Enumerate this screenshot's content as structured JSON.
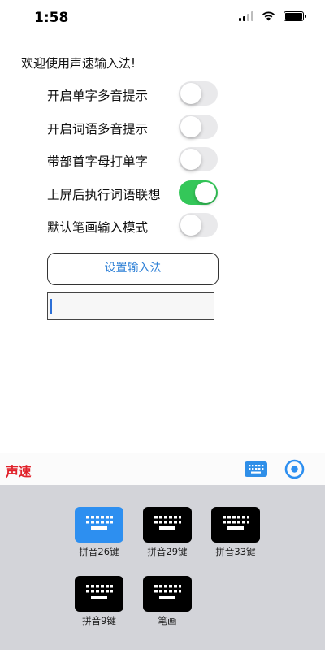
{
  "status_bar": {
    "time": "1:58",
    "icons": [
      "signal-icon",
      "wifi-icon",
      "battery-icon"
    ]
  },
  "welcome_text": "欢迎使用声速输入法!",
  "settings": [
    {
      "label": "开启单字多音提示",
      "enabled": false
    },
    {
      "label": "开启词语多音提示",
      "enabled": false
    },
    {
      "label": "带部首字母打单字",
      "enabled": false
    },
    {
      "label": "上屏后执行词语联想",
      "enabled": true
    },
    {
      "label": "默认笔画输入模式",
      "enabled": false
    }
  ],
  "setup_button_label": "设置输入法",
  "test_input": {
    "value": ""
  },
  "keyboard_toolbar": {
    "brand": "声速",
    "icons": [
      "keyboard-icon",
      "settings-target-icon"
    ]
  },
  "keyboard_layouts": [
    {
      "label": "拼音26键",
      "selected": true
    },
    {
      "label": "拼音29键",
      "selected": false
    },
    {
      "label": "拼音33键",
      "selected": false
    },
    {
      "label": "拼音9键",
      "selected": false
    },
    {
      "label": "笔画",
      "selected": false
    }
  ],
  "colors": {
    "toggle_on": "#34c759",
    "toggle_off": "#e9e9eb",
    "accent_blue": "#2d8ff0",
    "brand_red": "#e1212a",
    "keyboard_bg": "#d3d4d9"
  }
}
